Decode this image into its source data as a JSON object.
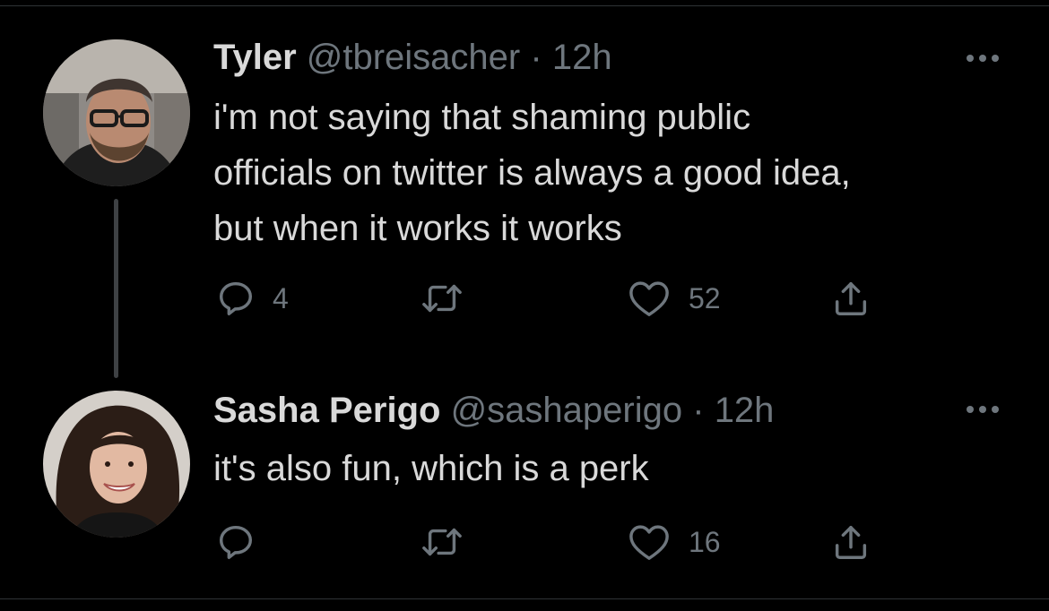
{
  "tweets": [
    {
      "name": "Tyler",
      "handle": "@tbreisacher",
      "separator": "·",
      "time": "12h",
      "text_lines": [
        "i'm not saying that shaming public",
        "officials on twitter is always a good idea,",
        "but when it works it works"
      ],
      "reply_count": "4",
      "retweet_count": "",
      "like_count": "52"
    },
    {
      "name": "Sasha Perigo",
      "handle": "@sashaperigo",
      "separator": "·",
      "time": "12h",
      "text_lines": [
        "it's also fun, which is a perk"
      ],
      "reply_count": "",
      "retweet_count": "",
      "like_count": "16"
    }
  ],
  "icons": {
    "reply": "reply-icon",
    "retweet": "retweet-icon",
    "like": "heart-icon",
    "share": "share-icon",
    "more": "more-icon"
  },
  "colors": {
    "background": "#000000",
    "text_primary": "#d9d9d9",
    "text_secondary": "#6e767d",
    "thread_line": "#3e4144"
  }
}
